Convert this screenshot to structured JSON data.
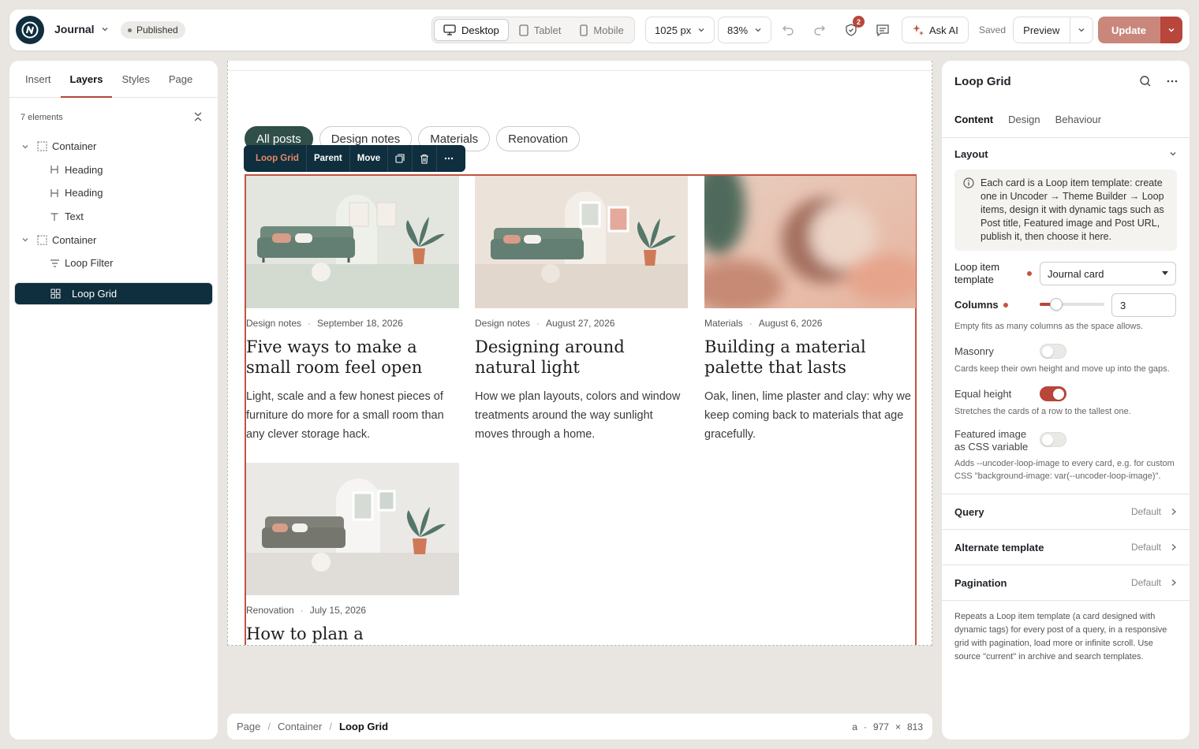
{
  "app": {
    "site_name": "Journal",
    "status": "Published"
  },
  "toolbar": {
    "devices": [
      {
        "label": "Desktop",
        "icon": "desktop-icon",
        "active": true
      },
      {
        "label": "Tablet",
        "icon": "tablet-icon",
        "active": false
      },
      {
        "label": "Mobile",
        "icon": "mobile-icon",
        "active": false
      }
    ],
    "width_value": "1025 px",
    "zoom_value": "83%",
    "notification_count": "2",
    "ask_ai_label": "Ask AI",
    "saved_label": "Saved",
    "preview_label": "Preview",
    "update_label": "Update"
  },
  "left_panel": {
    "tabs": [
      "Insert",
      "Layers",
      "Styles",
      "Page"
    ],
    "active_tab": "Layers",
    "element_count": "7 elements",
    "tree": [
      {
        "label": "Container",
        "icon": "container-icon",
        "level": 0,
        "expandable": true
      },
      {
        "label": "Heading",
        "icon": "heading-icon",
        "level": 1
      },
      {
        "label": "Heading",
        "icon": "heading-icon",
        "level": 1
      },
      {
        "label": "Text",
        "icon": "text-icon",
        "level": 1
      },
      {
        "label": "Container",
        "icon": "container-icon",
        "level": 0,
        "expandable": true
      },
      {
        "label": "Loop Filter",
        "icon": "filter-icon",
        "level": 1
      },
      {
        "label": "Loop Grid",
        "icon": "grid-icon",
        "level": 1,
        "selected": true
      }
    ]
  },
  "canvas": {
    "filters": [
      {
        "label": "All posts",
        "active": true
      },
      {
        "label": "Design notes",
        "active": false
      },
      {
        "label": "Materials",
        "active": false
      },
      {
        "label": "Renovation",
        "active": false
      }
    ],
    "element_toolbar": {
      "name": "Loop Grid",
      "parent": "Parent",
      "move": "Move"
    },
    "posts": [
      {
        "category": "Design notes",
        "date": "September 18, 2026",
        "title": "Five ways to make a small room feel open",
        "excerpt": "Light, scale and a few honest pieces of furniture do more for a small room than any clever storage hack.",
        "image": "living-room-illustration"
      },
      {
        "category": "Design notes",
        "date": "August 27, 2026",
        "title": "Designing around natural light",
        "excerpt": "How we plan layouts, colors and window treatments around the way sunlight moves through a home.",
        "image": "living-room-illustration-warm"
      },
      {
        "category": "Materials",
        "date": "August 6, 2026",
        "title": "Building a material palette that lasts",
        "excerpt": "Oak, linen, lime plaster and clay: why we keep coming back to materials that age gracefully.",
        "image": "abstract-blur-image"
      },
      {
        "category": "Renovation",
        "date": "July 15, 2026",
        "title": "How to plan a",
        "excerpt": "",
        "image": "living-room-illustration-grey"
      }
    ]
  },
  "breadcrumb": {
    "items": [
      "Page",
      "Container",
      "Loop Grid"
    ],
    "tag": "a",
    "width": "977",
    "times": "×",
    "height": "813"
  },
  "right_panel": {
    "title": "Loop Grid",
    "tabs": [
      "Content",
      "Design",
      "Behaviour"
    ],
    "active_tab": "Content",
    "layout_section": "Layout",
    "info_text": "Each card is a Loop item template: create one in Uncoder → Theme Builder → Loop items, design it with dynamic tags such as Post title, Featured image and Post URL, publish it, then choose it here.",
    "loop_item_label": "Loop item template",
    "loop_item_value": "Journal card",
    "columns_label": "Columns",
    "columns_value": "3",
    "columns_slider_fraction": 0.25,
    "columns_hint": "Empty fits as many columns as the space allows.",
    "masonry_label": "Masonry",
    "masonry_on": false,
    "masonry_hint": "Cards keep their own height and move up into the gaps.",
    "equal_height_label": "Equal height",
    "equal_height_on": true,
    "equal_height_hint": "Stretches the cards of a row to the tallest one.",
    "featured_label": "Featured image as CSS variable",
    "featured_on": false,
    "featured_hint": "Adds --uncoder-loop-image to every card, e.g. for custom CSS \"background-image: var(--uncoder-loop-image)\".",
    "accordions": [
      {
        "label": "Query",
        "value": "Default"
      },
      {
        "label": "Alternate template",
        "value": "Default"
      },
      {
        "label": "Pagination",
        "value": "Default"
      }
    ],
    "description": "Repeats a Loop item template (a card designed with dynamic tags) for every post of a query, in a responsive grid with pagination, load more or infinite scroll. Use source \"current\" in archive and search templates."
  },
  "colors": {
    "accent": "#b8463a",
    "brand_dark": "#0f2e3e",
    "active_filter": "#2f4f48"
  }
}
